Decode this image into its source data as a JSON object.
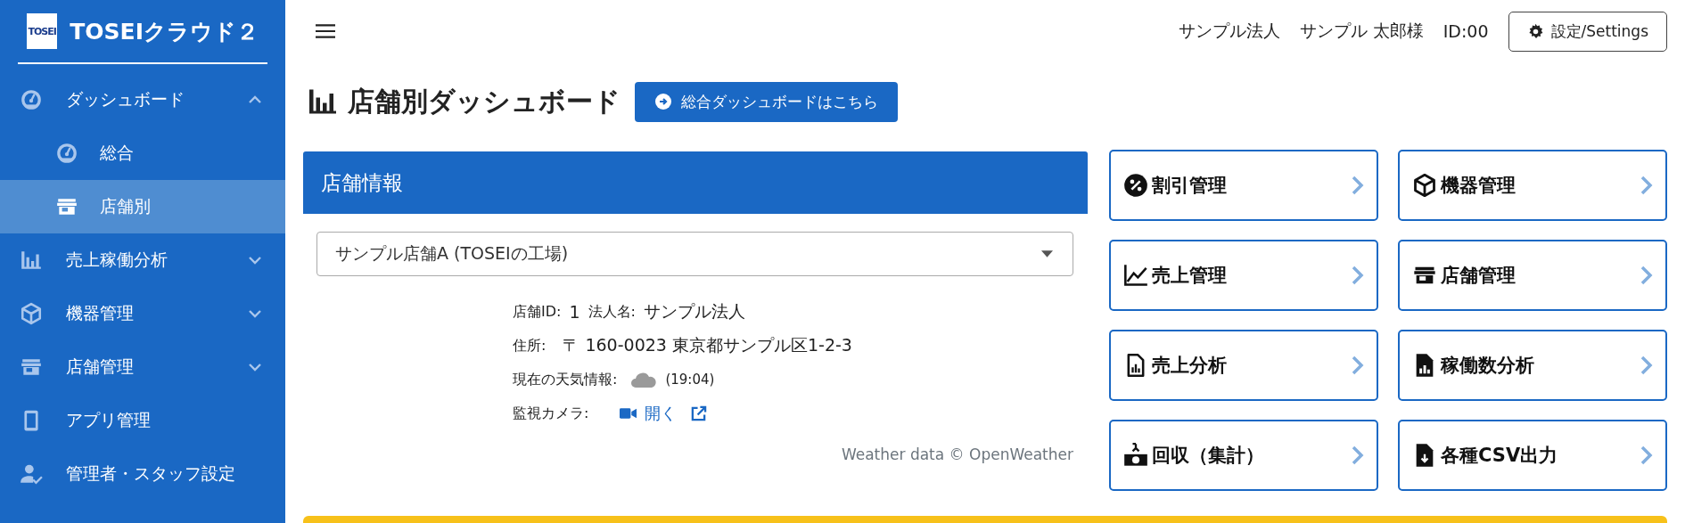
{
  "sidebar": {
    "logo_badge": "TOSEI",
    "title": "TOSEIクラウド２",
    "items": [
      {
        "label": "ダッシュボード",
        "kind": "gauge",
        "expanded": true,
        "selected": false,
        "children": [
          {
            "label": "総合",
            "kind": "gauge",
            "selected": false
          },
          {
            "label": "店舗別",
            "kind": "store",
            "selected": true
          }
        ]
      },
      {
        "label": "売上稼働分析",
        "kind": "bars",
        "expanded": false,
        "selected": false
      },
      {
        "label": "機器管理",
        "kind": "cube",
        "expanded": false,
        "selected": false
      },
      {
        "label": "店舗管理",
        "kind": "store",
        "expanded": false,
        "selected": false
      },
      {
        "label": "アプリ管理",
        "kind": "phone",
        "selected": false
      },
      {
        "label": "管理者・スタッフ設定",
        "kind": "user",
        "selected": false
      }
    ]
  },
  "header": {
    "company": "サンプル法人",
    "user": "サンプル 太郎様",
    "user_id": "ID:00",
    "settings_button": "設定/Settings"
  },
  "page": {
    "title": "店舗別ダッシュボード",
    "overall_button": "総合ダッシュボードはこちら"
  },
  "store_panel": {
    "title": "店舗情報",
    "store_select": "サンプル店舗A (TOSEIの工場)",
    "store_id_label": "店舗ID:",
    "store_id": "1",
    "company_label": "法人名:",
    "company": "サンプル法人",
    "address_label": "住所:",
    "address": "〒 160-0023 東京都サンプル区1-2-3",
    "weather_label": "現在の天気情報:",
    "weather_time": "(19:04)",
    "camera_label": "監視カメラ:",
    "camera_link": "開く",
    "credit": "Weather data © OpenWeather"
  },
  "shortcuts": [
    {
      "label": "割引管理",
      "kind": "percent"
    },
    {
      "label": "機器管理",
      "kind": "cube"
    },
    {
      "label": "売上管理",
      "kind": "line"
    },
    {
      "label": "店舗管理",
      "kind": "store"
    },
    {
      "label": "売上分析",
      "kind": "report"
    },
    {
      "label": "稼働数分析",
      "kind": "report-filled"
    },
    {
      "label": "回収（集計）",
      "kind": "money"
    },
    {
      "label": "各種CSV出力",
      "kind": "download"
    }
  ]
}
